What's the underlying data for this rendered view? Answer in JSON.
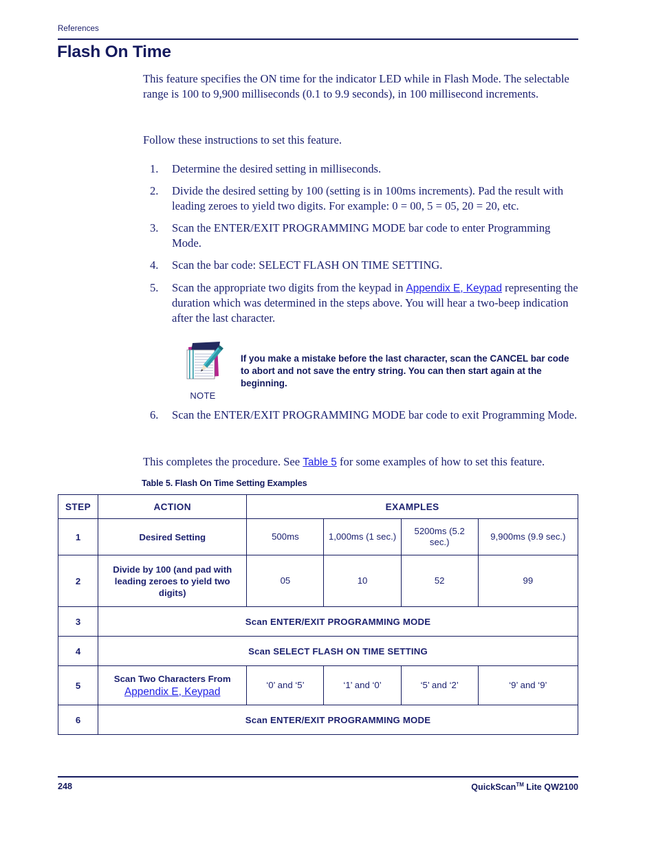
{
  "running_head": "References",
  "title": "Flash On Time",
  "intro": {
    "paragraph": "This feature specifies the ON time for the indicator LED while in Flash Mode. The selectable range is 100 to 9,900 milliseconds (0.1 to 9.9 seconds), in 100 millisecond increments.",
    "follow": "Follow these instructions to set this feature."
  },
  "steps": [
    {
      "text": "Determine the desired setting in milliseconds."
    },
    {
      "text": "Divide the desired setting by 100 (setting is in 100ms increments). Pad the result with leading zeroes to yield two digits. For example: 0 = 00, 5 = 05, 20 = 20, etc."
    },
    {
      "text": "Scan the ENTER/EXIT PROGRAMMING MODE bar code to enter Programming Mode."
    },
    {
      "text": "Scan the bar code: SELECT FLASH ON TIME SETTING."
    },
    {
      "text_before": "Scan the appropriate two digits from the keypad in ",
      "link": "Appendix E, Keypad",
      "text_after": " representing the duration which was determined in the steps above. You will hear a two-beep indication after the last character."
    },
    {
      "text": "Scan the ENTER/EXIT PROGRAMMING MODE bar code to exit Programming Mode."
    }
  ],
  "note": {
    "label": "NOTE",
    "text": "If you make a mistake before the last character, scan the CANCEL bar code to abort and not save the entry string. You can then start again at the beginning.",
    "icon": "notepad-pencil-icon"
  },
  "closing": {
    "text_before": "This completes the procedure. See ",
    "link": "Table 5",
    "text_after": " for some examples of how to set this feature."
  },
  "table": {
    "caption": "Table 5. Flash On Time Setting Examples",
    "headers": {
      "step": "STEP",
      "action": "ACTION",
      "examples": "EXAMPLES"
    },
    "rows": [
      {
        "step": "1",
        "action": "Desired Setting",
        "values": [
          "500ms",
          "1,000ms (1 sec.)",
          "5200ms (5.2 sec.)",
          "9,900ms (9.9 sec.)"
        ]
      },
      {
        "step": "2",
        "action": "Divide by 100 (and pad with leading zeroes to yield two digits)",
        "values": [
          "05",
          "10",
          "52",
          "99"
        ]
      },
      {
        "step": "3",
        "span_text": "Scan ENTER/EXIT PROGRAMMING MODE"
      },
      {
        "step": "4",
        "span_text": "Scan SELECT FLASH ON TIME SETTING"
      },
      {
        "step": "5",
        "action": "Scan Two Characters From",
        "action_link": "Appendix E, Keypad",
        "values": [
          "‘0’ and ‘5’",
          "‘1’ and ‘0’",
          "‘5’ and ‘2’",
          "‘9’ and ‘9’"
        ]
      },
      {
        "step": "6",
        "span_text": "Scan ENTER/EXIT PROGRAMMING MODE"
      }
    ]
  },
  "footer": {
    "page_number": "248",
    "product_main": "QuickScan",
    "product_tm": "TM",
    "product_rest": " Lite QW2100"
  },
  "colors": {
    "navy": "#141a5e",
    "body_navy": "#1d2270",
    "link_blue": "#2222e6",
    "icon_teal": "#2e9aa8",
    "icon_magenta": "#b5258e",
    "icon_dark": "#22295e"
  }
}
